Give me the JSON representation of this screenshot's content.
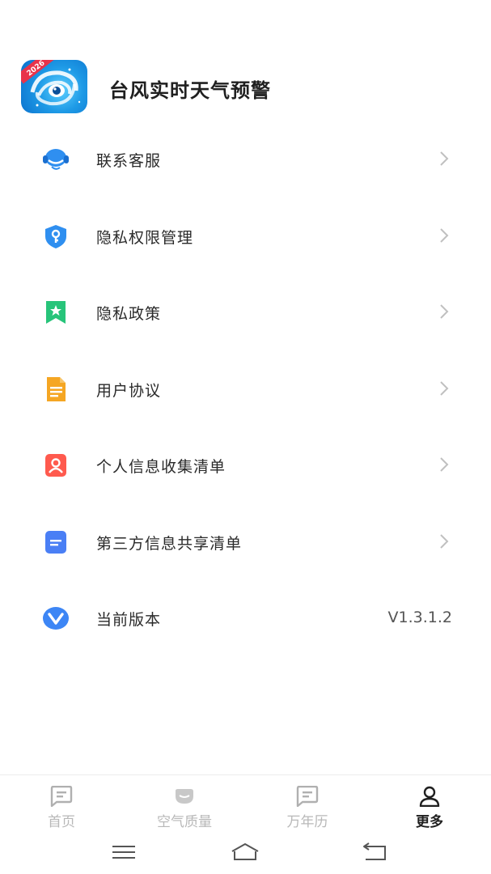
{
  "app": {
    "title": "台风实时天气预警",
    "logo_badge": "2026"
  },
  "menu": [
    {
      "label": "联系客服",
      "icon": "headset-icon",
      "color": "#2f8ff0"
    },
    {
      "label": "隐私权限管理",
      "icon": "shield-key-icon",
      "color": "#2f8ff0"
    },
    {
      "label": "隐私政策",
      "icon": "bookmark-star-icon",
      "color": "#27c47a"
    },
    {
      "label": "用户协议",
      "icon": "document-icon",
      "color": "#f5a623"
    },
    {
      "label": "个人信息收集清单",
      "icon": "person-card-icon",
      "color": "#ff5a4e"
    },
    {
      "label": "第三方信息共享清单",
      "icon": "list-card-icon",
      "color": "#4a7ff5"
    },
    {
      "label": "当前版本",
      "icon": "version-v-icon",
      "color": "#3d86f5",
      "value": "V1.3.1.2"
    }
  ],
  "tabs": [
    {
      "label": "首页",
      "icon": "home-chat-icon",
      "active": false
    },
    {
      "label": "空气质量",
      "icon": "air-quality-icon",
      "active": false
    },
    {
      "label": "万年历",
      "icon": "calendar-chat-icon",
      "active": false
    },
    {
      "label": "更多",
      "icon": "user-icon",
      "active": true
    }
  ],
  "colors": {
    "active_tab": "#1f1f1f",
    "inactive_tab": "#b8b8b8",
    "chevron": "#c0c0c0"
  }
}
